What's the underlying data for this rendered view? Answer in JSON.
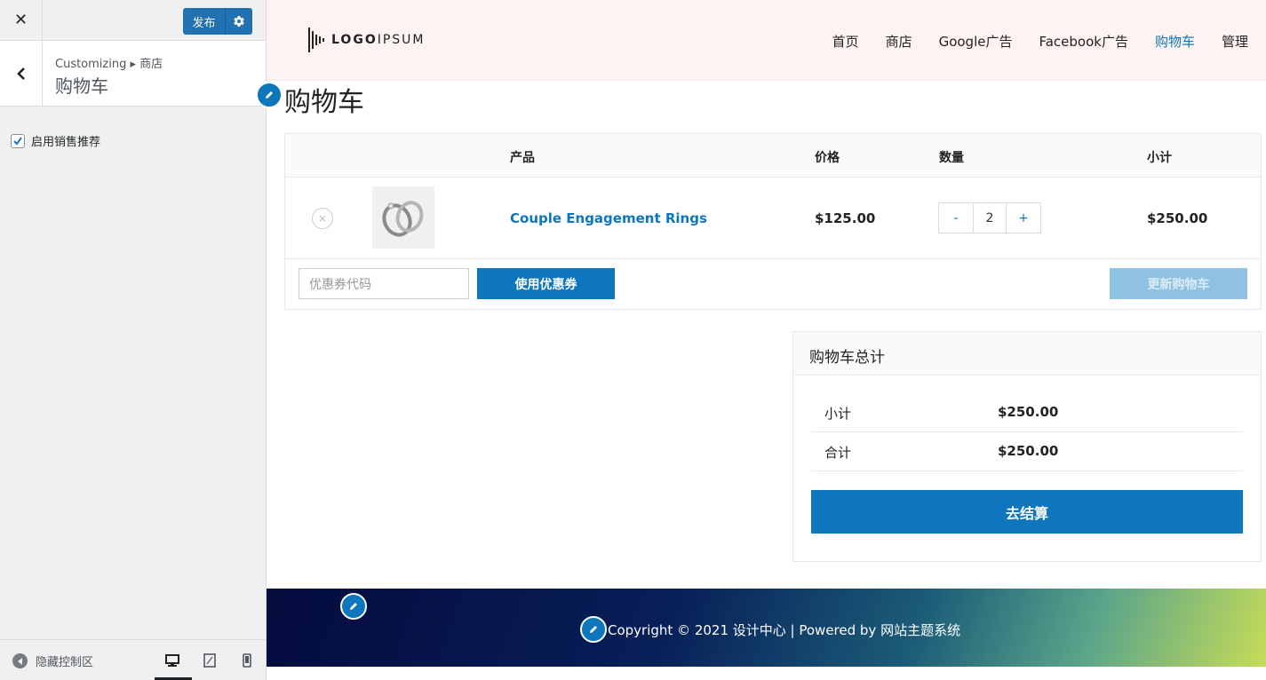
{
  "customizer": {
    "close_label": "✕",
    "publish_label": "发布",
    "breadcrumb": "Customizing ▸ 商店",
    "section_title": "购物车",
    "upsell_option_label": "启用销售推荐",
    "upsell_checked": true,
    "collapse_label": "隐藏控制区"
  },
  "site": {
    "logo_text_bold": "LOGO",
    "logo_text_light": "IPSUM",
    "nav": [
      "首页",
      "商店",
      "Google广告",
      "Facebook广告",
      "购物车",
      "管理"
    ],
    "nav_active_index": 4,
    "accent_color": "#0e76bc"
  },
  "cart": {
    "page_title": "购物车",
    "columns": {
      "product": "产品",
      "price": "价格",
      "quantity": "数量",
      "subtotal": "小计"
    },
    "item": {
      "name": "Couple Engagement Rings",
      "price": "$125.00",
      "quantity": "2",
      "qty_minus": "-",
      "qty_plus": "+",
      "subtotal": "$250.00",
      "remove": "×"
    },
    "coupon_placeholder": "优惠券代码",
    "apply_coupon_label": "使用优惠券",
    "update_cart_label": "更新购物车"
  },
  "totals": {
    "title": "购物车总计",
    "subtotal_label": "小计",
    "subtotal_value": "$250.00",
    "total_label": "合计",
    "total_value": "$250.00",
    "checkout_label": "去结算"
  },
  "footer": {
    "copyright": "Copyright © 2021 设计中心 | Powered by 网站主题系统"
  }
}
